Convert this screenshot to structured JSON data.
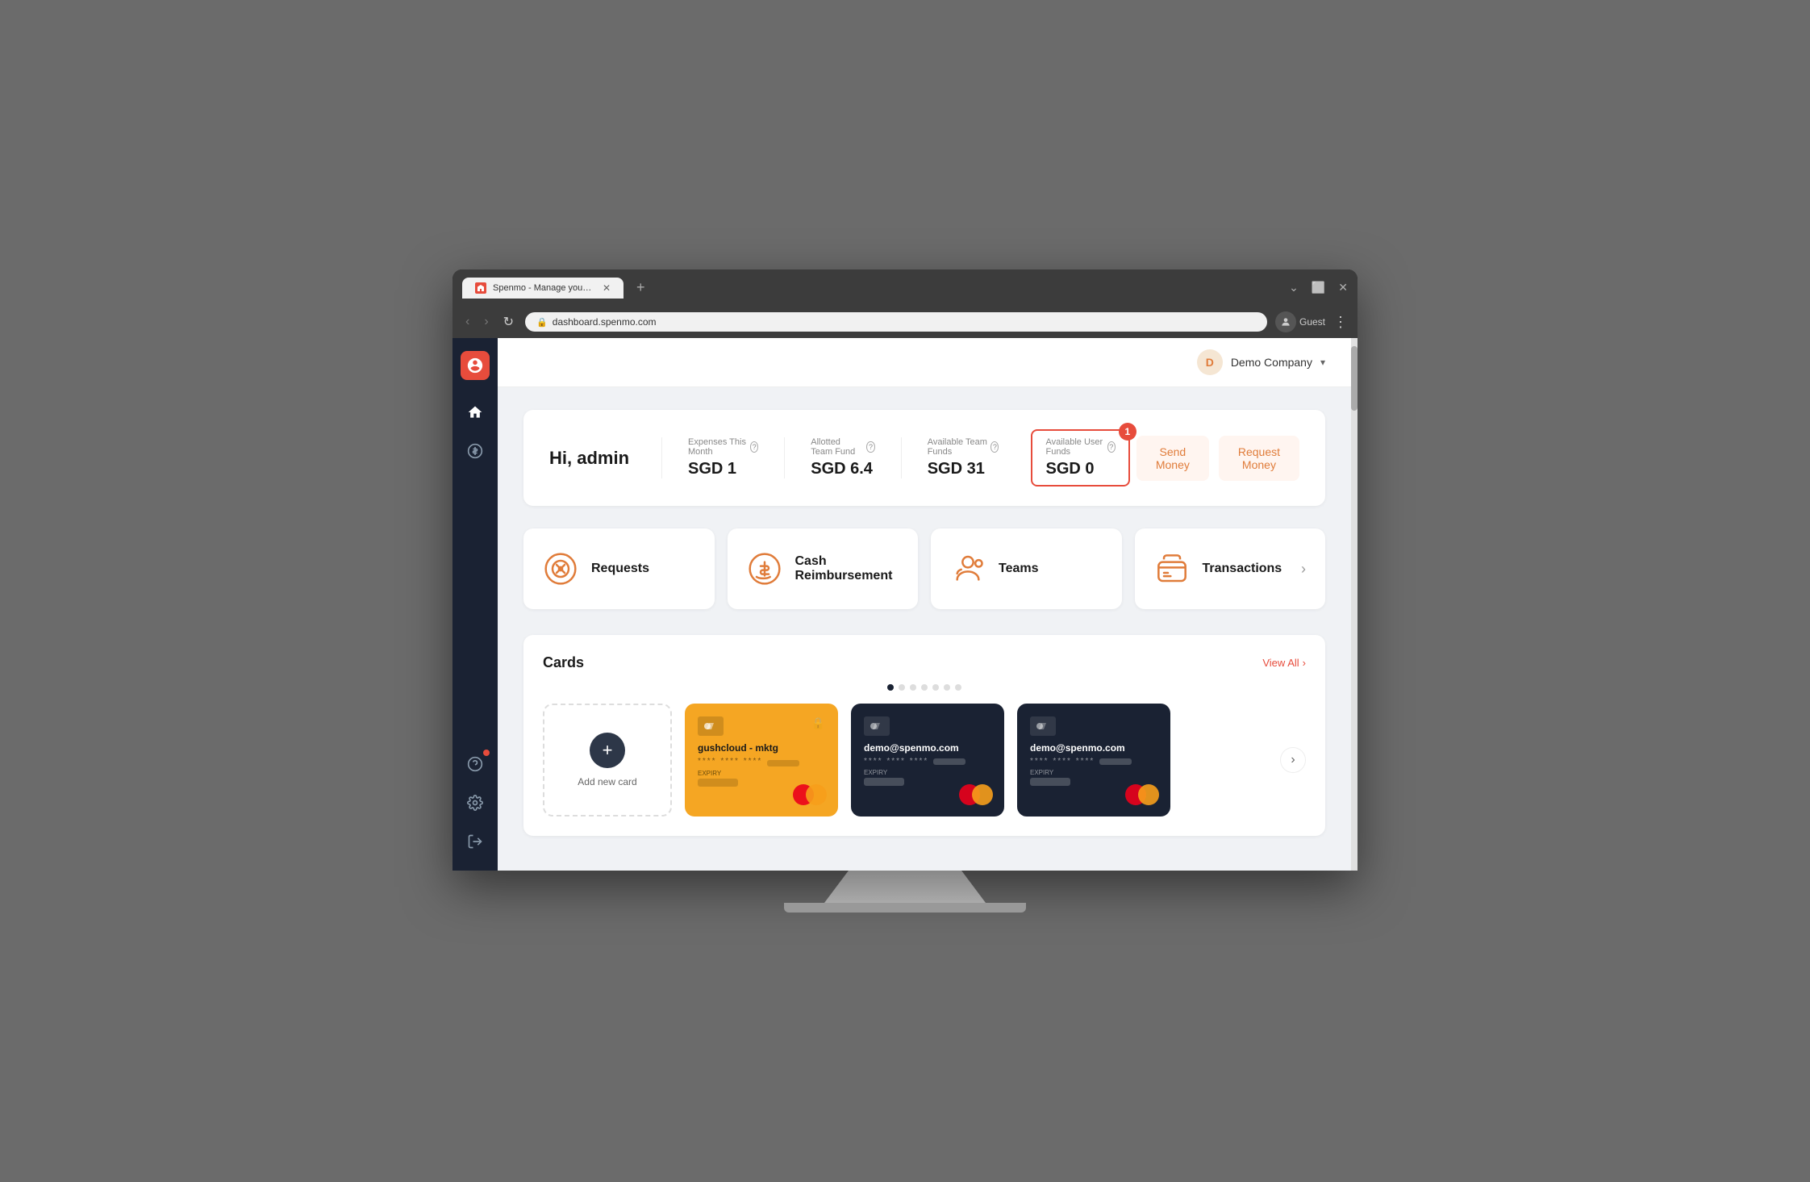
{
  "browser": {
    "tab_title": "Spenmo - Manage your compan...",
    "url": "dashboard.spenmo.com",
    "profile_label": "Guest"
  },
  "header": {
    "company_initial": "D",
    "company_name": "Demo Company"
  },
  "stats": {
    "greeting": "Hi, admin",
    "expenses_label": "Expenses This Month",
    "expenses_value": "SGD 1",
    "allotted_label": "Allotted Team Fund",
    "allotted_value": "SGD 6.4",
    "available_team_label": "Available Team Funds",
    "available_team_value": "SGD 31",
    "available_user_label": "Available User Funds",
    "available_user_value": "SGD 0",
    "notification_count": "1",
    "send_money_label": "Send Money",
    "request_money_label": "Request Money"
  },
  "tiles": [
    {
      "id": "requests",
      "label": "Requests",
      "icon": "search-dollar"
    },
    {
      "id": "cash-reimbursement",
      "label": "Cash Reimbursement",
      "icon": "cash"
    },
    {
      "id": "teams",
      "label": "Teams",
      "icon": "settings-group"
    },
    {
      "id": "transactions",
      "label": "Transactions",
      "icon": "card"
    }
  ],
  "cards_section": {
    "title": "Cards",
    "view_all_label": "View All",
    "add_card_label": "Add new card",
    "carousel_dots": [
      true,
      false,
      false,
      false,
      false,
      false,
      false
    ]
  },
  "cards": [
    {
      "id": "card-orange",
      "type": "orange",
      "name": "gushcloud - mktg",
      "number_masked": "**** **** ****",
      "number_last": "•••••",
      "expiry_label": "EXPIRY",
      "expiry_val": ""
    },
    {
      "id": "card-dark-1",
      "type": "dark",
      "name": "demo@spenmo.com",
      "number_masked": "**** **** ****",
      "number_last": "•••••",
      "expiry_label": "EXPIRY",
      "expiry_val": ""
    },
    {
      "id": "card-dark-2",
      "type": "dark",
      "name": "demo@spenmo.com",
      "number_masked": "**** **** ****",
      "number_last": "•••••",
      "expiry_label": "EXPIRY",
      "expiry_val": ""
    }
  ],
  "sidebar": {
    "items": [
      {
        "id": "home",
        "icon": "home"
      },
      {
        "id": "dollar",
        "icon": "dollar-circle"
      },
      {
        "id": "help",
        "icon": "help-circle",
        "badge": true
      },
      {
        "id": "settings",
        "icon": "settings"
      },
      {
        "id": "logout",
        "icon": "logout"
      }
    ]
  }
}
